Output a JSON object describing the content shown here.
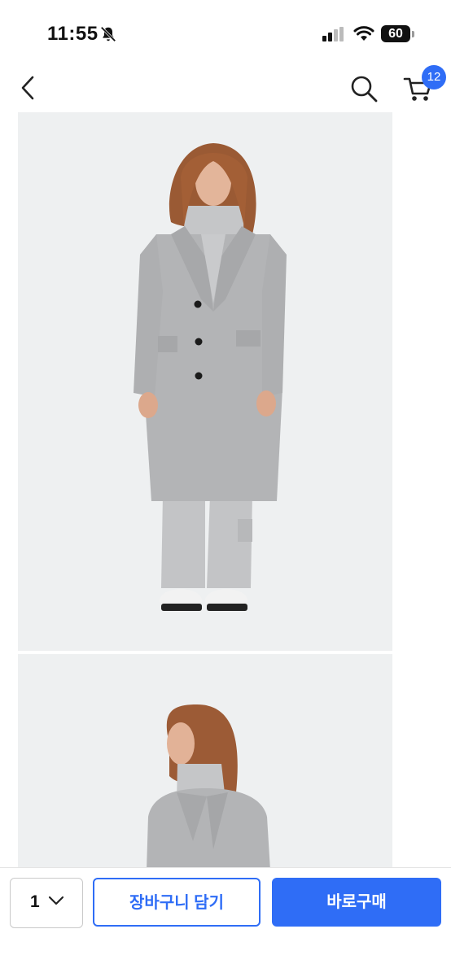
{
  "status_bar": {
    "time": "11:55",
    "battery": "60",
    "icons": [
      "bell-slash-icon",
      "cellular-signal-icon",
      "wifi-icon",
      "battery-icon"
    ]
  },
  "nav": {
    "icons": [
      "chevron-left-icon",
      "search-icon",
      "cart-icon"
    ],
    "cart_count": "12"
  },
  "colors": {
    "accent": "#2f6df6",
    "image_background": "#eef0f1",
    "coat": "#b3b4b6"
  },
  "purchase": {
    "quantity": "1",
    "add_to_cart_label": "장바구니 담기",
    "buy_now_label": "바로구매"
  }
}
